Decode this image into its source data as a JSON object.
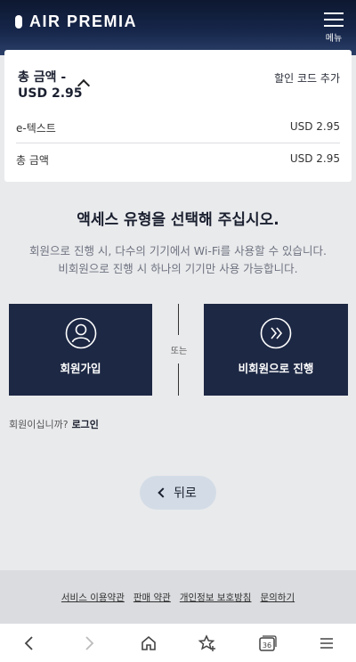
{
  "header": {
    "logo_text": "AIR PREMIA",
    "menu_label": "메뉴"
  },
  "summary": {
    "total_title_line1": "총 금액 -",
    "total_title_line2": "USD 2.95",
    "discount_link": "할인 코드 추가",
    "rows": [
      {
        "label": "e-텍스트",
        "value": "USD 2.95"
      },
      {
        "label": "총 금액",
        "value": "USD 2.95"
      }
    ]
  },
  "main": {
    "heading": "액세스 유형을 선택해 주십시오.",
    "desc_line1": "회원으로 진행 시, 다수의 기기에서 Wi-Fi를 사용할 수 있습니다.",
    "desc_line2": "비회원으로 진행 시 하나의 기기만 사용 가능합니다.",
    "member_label": "회원가입",
    "or_text": "또는",
    "guest_label": "비회원으로 진행",
    "member_question": "회원이십니까?",
    "login_link": "로그인",
    "back_label": "뒤로"
  },
  "footer": {
    "links": [
      "서비스 이용약관",
      "판매 약관",
      "개인정보 보호방침",
      "문의하기"
    ]
  },
  "browser": {
    "tab_count": "36"
  },
  "colors": {
    "header_bg": "#16264a",
    "card_bg": "#1d2844",
    "back_btn_bg": "#d3dce6"
  }
}
